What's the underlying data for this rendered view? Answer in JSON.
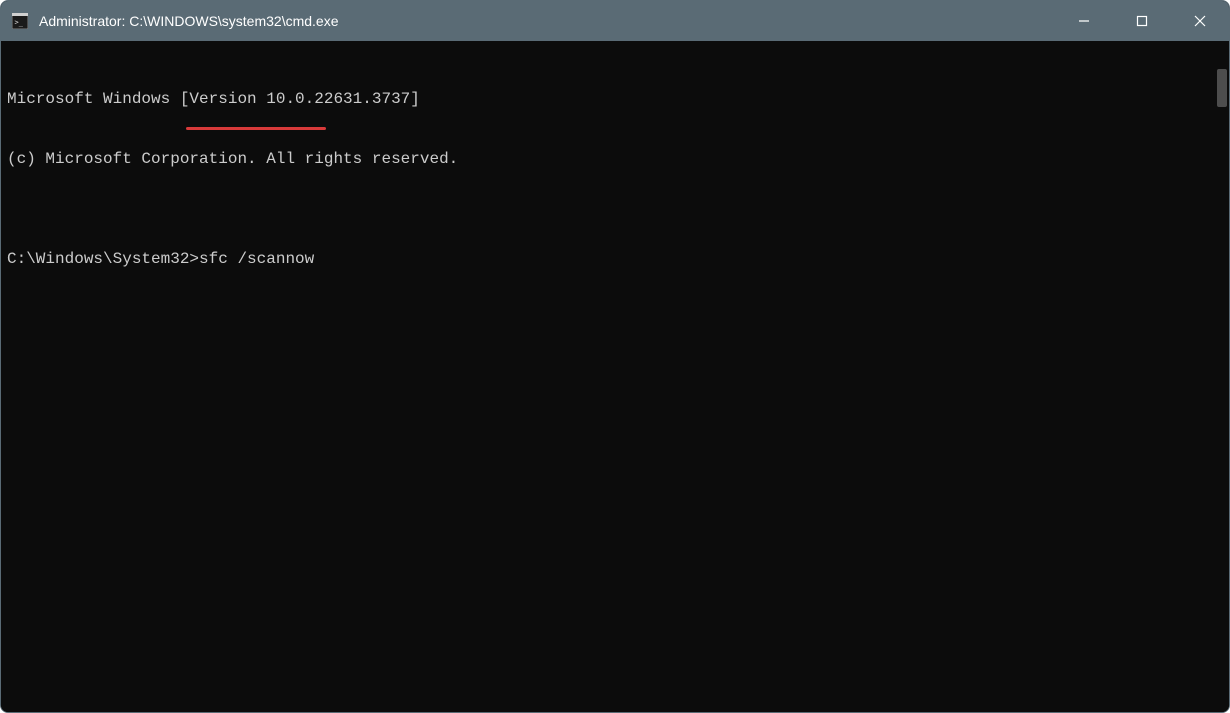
{
  "window": {
    "title": "Administrator: C:\\WINDOWS\\system32\\cmd.exe",
    "icon_name": "cmd-icon"
  },
  "titlebar_controls": {
    "minimize_label": "Minimize",
    "maximize_label": "Maximize",
    "close_label": "Close"
  },
  "terminal": {
    "lines": [
      "Microsoft Windows [Version 10.0.22631.3737]",
      "(c) Microsoft Corporation. All rights reserved.",
      "",
      "C:\\Windows\\System32>sfc /scannow"
    ],
    "prompt": "C:\\Windows\\System32>",
    "command": "sfc /scannow",
    "version": "10.0.22631.3737",
    "highlight": {
      "color": "#d93a3a",
      "target_text": "sfc /scannow"
    }
  }
}
